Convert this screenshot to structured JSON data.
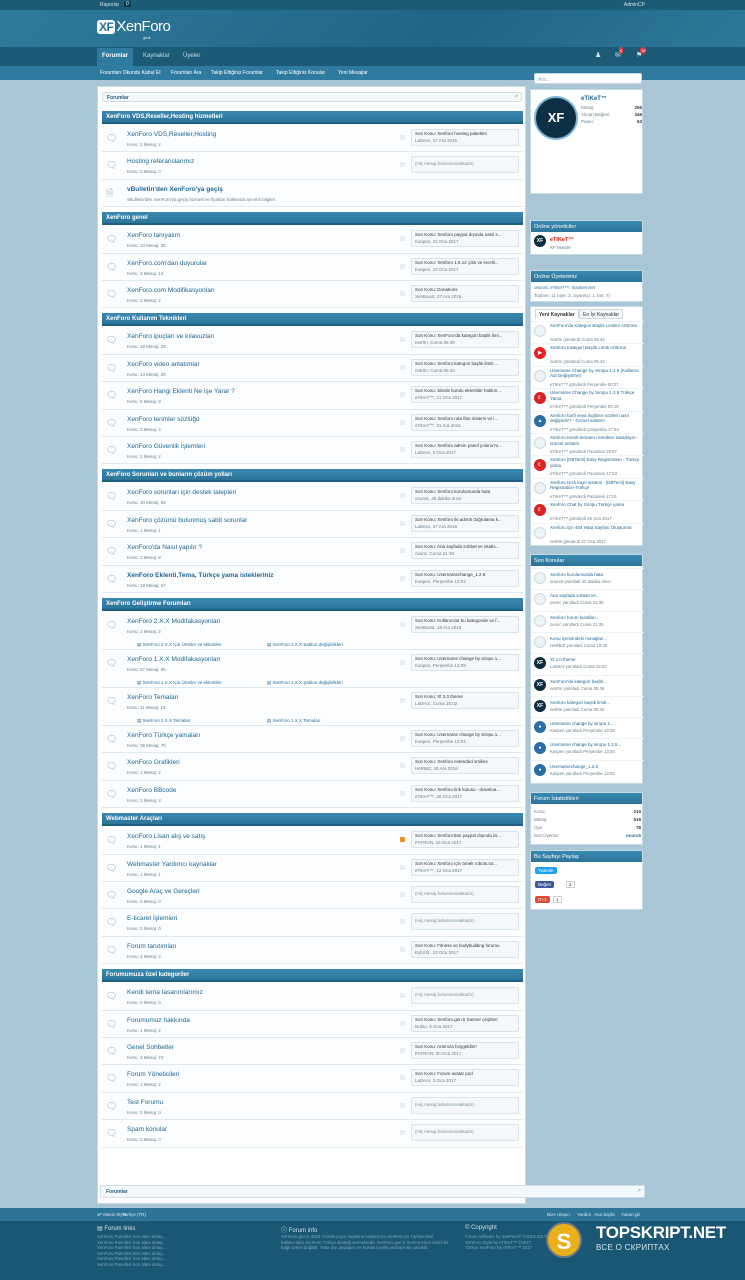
{
  "topbar": {
    "reports": "Raporlar",
    "reports_count": "0",
    "admincp": "AdminCP"
  },
  "logo": {
    "mark": "XF",
    "name": "XenForo",
    "sub": "gen.tr"
  },
  "nav": {
    "tabs": [
      "Forumlar",
      "Kaynaklar",
      "Üyeler"
    ],
    "notif1": "9",
    "notif2": "19"
  },
  "subnav": [
    "Forumları Okundu Kabul Et",
    "Forumları Ara",
    "Takip Ettiğiniz Forumlar",
    "Takip Ettiğiniz Konular",
    "Yeni Mesajlar"
  ],
  "breadcrumb": "Forumlar",
  "categories": [
    {
      "title": "XenForo VDS,Reseller,Hosting hizmetleri",
      "nodes": [
        {
          "title": "XenForo VDS,Reseller,Hosting",
          "stats": "Konu: 2  Mesaj: 2",
          "last1": "Son Konu: Xenforo hosting paketleri",
          "last2": "LaDecs, 27 Ara 2016",
          "bold": false,
          "icon": "bubble"
        },
        {
          "title": "Hosting referanslarımız",
          "stats": "Konu: 0  Mesaj: 0",
          "empty": "(Hiç mesaj bulunmamaktadır)",
          "icon": "bubble"
        },
        {
          "title": "vBulletin'den XenForo'ya geçiş",
          "stats": "vBulletin'den XenForo'ya geçiş hizmeti ve fiyatları hakkında ayrıntılı bilgiler.",
          "bold": true,
          "icon": "doc"
        }
      ]
    },
    {
      "title": "XenForo genel",
      "nodes": [
        {
          "title": "XenForo tanıyalım",
          "stats": "Konu: 10  Mesaj: 35",
          "last1": "Son Konu: Xenforo paypal dışında nasıl s...",
          "last2": "Kaspen, 22 Oca 2017",
          "icon": "bubble"
        },
        {
          "title": "XenForo.com'dan duyurular",
          "stats": "Konu: 3  Mesaj: 12",
          "last1": "Son Konu: Xenforo 1.5.12 çıktı ve incelil...",
          "last2": "Kaspen, 10 Oca 2017",
          "icon": "bubble"
        },
        {
          "title": "XenForo.com Modifikasyonları",
          "stats": "Konu: 2  Mesaj: 2",
          "last1": "Son Konu: Donations",
          "last2": "XenBoost, 27 Ara 2016",
          "icon": "bubble"
        }
      ]
    },
    {
      "title": "XenForo Kullanım Teknikleri",
      "nodes": [
        {
          "title": "XenForo ipuçları ve kılavuzları",
          "stats": "Konu: 18  Mesaj: 28",
          "last1": "Son Konu: XenForo'da kategori başlık limi...",
          "last2": "netr0n, Cuma 05:45",
          "icon": "bubble"
        },
        {
          "title": "XenForo video anlatımlar",
          "stats": "Konu: 13  Mesaj: 20",
          "last1": "Son Konu: Xenforo kategori başlık limiti ...",
          "last2": "netr0n, Cuma 05:42",
          "icon": "bubble"
        },
        {
          "title": "XenForo Hangi Eklenti Ne işe Yarar ?",
          "stats": "Konu: 5  Mesaj: 8",
          "last1": "Son Konu: Sitede kurulu eklentiler hakkın...",
          "last2": "eTiKeT™, 21 Oca 2017",
          "icon": "bubble"
        },
        {
          "title": "XenForo terimler sözlüğü",
          "stats": "Konu: 3  Mesaj: 4",
          "last1": "Son Konu: Xenforo rota fitre sistemi ve i...",
          "last2": "eTiKeT™, 31 Ara 2016",
          "icon": "bubble"
        },
        {
          "title": "XenForo Güvenlik İşlemleri",
          "stats": "Konu: 2  Mesaj: 2",
          "last1": "Son Konu: Xenforo admin panel yolunu?o...",
          "last2": "LaDecs, 5 Oca 2017",
          "icon": "bubble"
        }
      ]
    },
    {
      "title": "XenForo Sorunları ve bunların çözüm yolları",
      "nodes": [
        {
          "title": "XenForo sorunları için destek talepleri",
          "stats": "Konu: 10  Mesaj: 56",
          "last1": "Son Konu: Xenforo kurulumunda hata",
          "last2": "onurx5, 45 dakika önce",
          "icon": "bubble"
        },
        {
          "title": "XenForo çözümü bulunmuş sabit sorunlar",
          "stats": "Konu: 1  Mesaj: 1",
          "last1": "Son Konu: Xenforo iki adımlı doğrulama k...",
          "last2": "LaDecs, 27 Ara 2016",
          "icon": "bubble"
        },
        {
          "title": "XenForo'da Nasıl yapılır ?",
          "stats": "Konu: 2  Mesaj: 8",
          "last1": "Son Konu: Ana sayfada sohbet ve istatis...",
          "last2": "ovunc, Cuma 21:39",
          "icon": "bubble"
        },
        {
          "title": "XenForo Eklenti,Tema, Türkçe yama istekleriniz",
          "stats": "Konu: 18  Mesaj: 67",
          "last1": "Son Konu: Usernamechange_1.2.5",
          "last2": "Kaspen, Perşembe 13:04",
          "bold": true,
          "icon": "bubble"
        }
      ]
    },
    {
      "title": "XenForo Geliştirme Forumları",
      "nodes": [
        {
          "title": "XenForo 2.X.X Modifakasyonları",
          "stats": "Konu: 2  Mesaj: 2",
          "last1": "Son Konu: Kullanıcılar bu kategoride ve f...",
          "last2": "XenBoost, 18 Ara 2016",
          "icon": "bubble",
          "subs": [
            "XenForo 2.X.X İçin Ürünler ve eklentiler",
            "XenForo 2.X.X Şablon değişiklikleri"
          ]
        },
        {
          "title": "XenForo 1.X.X Modifakasyonları",
          "stats": "Konu: 57  Mesaj: 95",
          "last1": "Son Konu: Username change by siropu 1...",
          "last2": "Kaspen, Perşembe 13:09",
          "icon": "bubble",
          "subs": [
            "XenForo 1.X.X İçin Ürünler ve eklentiler",
            "XenForo 1.X.X Şablon değişiklikleri"
          ]
        },
        {
          "title": "XenForo Temaları",
          "stats": "Konu: 11  Mesaj: 19",
          "last1": "Son Konu: Xf 2.0 theme",
          "last2": "LaDecs, Cuma 15:02",
          "icon": "bubble",
          "subs": [
            "XenForo 2.X.X Temaları",
            "XenForo 1.X.X Temaları"
          ]
        },
        {
          "title": "XenForo Türkçe yamaları",
          "stats": "Konu: 36  Mesaj: 70",
          "last1": "Son Konu: Username change by siropu 1...",
          "last2": "Kaspen, Perşembe 13:04",
          "icon": "bubble"
        },
        {
          "title": "XenForo Grafikleri",
          "stats": "Konu: 1  Mesaj: 2",
          "last1": "Son Konu: Xenforo extended smilies",
          "last2": "HeRBIZ, 29 Ara 2016",
          "icon": "bubble"
        },
        {
          "title": "XenForo BBcode",
          "stats": "Konu: 3  Mesaj: 3",
          "last1": "Son Konu: Xenforo link kutusu - downloa...",
          "last2": "eTiKeT™, 28 Oca 2017",
          "icon": "bubble"
        }
      ]
    },
    {
      "title": "Webmaster Araçları",
      "nodes": [
        {
          "title": "XenForo Lisan alış ve satış",
          "stats": "Konu: 1  Mesaj: 1",
          "last1": "Son Konu: Xenforo'dan paypal dışında lis...",
          "last2": "PATRON, 19 Oca 2017",
          "icon": "bubble",
          "rss": "or"
        },
        {
          "title": "Webmaster Yardımcı kaynaklar",
          "stats": "Konu: 1  Mesaj: 1",
          "last1": "Son Konu: Xenforo için örnek robots.txt...",
          "last2": "eTiKeT™, 12 Oca 2017",
          "icon": "bubble"
        },
        {
          "title": "Google Araç ve Gereçleri",
          "stats": "Konu: 0  Mesaj: 0",
          "empty": "(Hiç mesaj bulunmamaktadır)",
          "icon": "bubble"
        },
        {
          "title": "E-ticaret İşlemleri",
          "stats": "Konu: 0  Mesaj: 0",
          "empty": "(Hiç mesaj bulunmamaktadır)",
          "icon": "bubble"
        },
        {
          "title": "Forum tanıtımları",
          "stats": "Konu: 4  Mesaj: 4",
          "last1": "Son Konu: Fitness ve bodybuilding forumu",
          "last2": "Eylül B., 23 Oca 2017",
          "icon": "bubble"
        }
      ]
    },
    {
      "title": "Forumumuza özel kategoriler",
      "nodes": [
        {
          "title": "Kendi tema tasarımlarımız",
          "stats": "Konu: 0  Mesaj: 0",
          "empty": "(Hiç mesaj bulunmamaktadır)",
          "icon": "bubble"
        },
        {
          "title": "Forumumuz hakkında",
          "stats": "Konu: 1  Mesaj: 2",
          "last1": "Son Konu: Xenforo.gen.tr banner çeşitleri",
          "last2": "Noktu, 6 Oca 2017",
          "icon": "bubble"
        },
        {
          "title": "Genel Sohbetler",
          "stats": "Konu: 3  Mesaj: 73",
          "last1": "Son Konu: Aramıza hoşgeldin!!",
          "last2": "PATRON, 30 Oca 2017",
          "icon": "bubble"
        },
        {
          "title": "Forum Yöneticileri",
          "stats": "Konu: 1  Mesaj: 2",
          "last1": "Son Konu: Forum avatar pod",
          "last2": "LaDecs, 3 Oca 2017",
          "icon": "bubble"
        },
        {
          "title": "Test Forumu",
          "stats": "Konu: 0  Mesaj: 0",
          "empty": "(Hiç mesaj bulunmamaktadır)",
          "icon": "bubble"
        },
        {
          "title": "Spam konular",
          "stats": "Konu: 0  Mesaj: 0",
          "empty": "(Hiç mesaj bulunmamaktadır)",
          "icon": "bubble"
        }
      ]
    }
  ],
  "sidebar": {
    "search_placeholder": "Ara...",
    "visitor": {
      "name": "eTiKeT™",
      "avatar": "XF",
      "stats": [
        [
          "Mesaj:",
          "206"
        ],
        [
          "Alınan Beğeni:",
          "346"
        ],
        [
          "Puanı:",
          "63"
        ]
      ]
    },
    "online_mods": {
      "title": "Online yöneticiler",
      "name": "eTiKeT™",
      "role": "XF Master"
    },
    "online_users": {
      "title": "Online Üyelerimiz",
      "users": "onurx5, eTiKeT™, maxkernner",
      "count": "Toplam: 11 (üye: 3, ziyaretçi: 1, bot: 7)"
    },
    "resources": {
      "tabs": [
        "Yeni Kaynaklar",
        "En İyi Kaynaklar"
      ],
      "items": [
        {
          "t": "XenForo'da Kategori Başlık Limitini Arttırma",
          "m": "netr0n gönderdi Cuma 05:45",
          "icon": "pk"
        },
        {
          "t": "Xenforo Kategori Başlık Limiti Arttırma",
          "m": "netr0n gönderdi Cuma 05:42",
          "icon": "rd"
        },
        {
          "t": "Username Change by Siropu 1.2.5 (Kullanıcı Adı Değiştirme)",
          "m": "eTiKeT™ gönderdi Perşembe 00:27",
          "icon": "pk"
        },
        {
          "t": "Username Change by Siropu 1.2.5 Türkçe Yama",
          "m": "eTiKeT™ gönderdi Perşembe 00:19",
          "icon": "tr"
        },
        {
          "t": "Xenforo harfi veya ingilizce sözleri nasıl değiştirilir? - Görsel anlatım",
          "m": "eTiKeT™ gönderdi Çarşamba 17:54",
          "icon": "bl"
        },
        {
          "t": "Xenforo Kendi temanızı kendiniz tasarlayın - Görsel anlatım",
          "m": "eTiKeT™ gönderdi Pazartesi 20:57",
          "icon": "pk"
        },
        {
          "t": "Xenforo [DBTech] Easy Registration - Türkçe yama",
          "m": "eTiKeT™ gönderdi Pazartesi 17:03",
          "icon": "tr"
        },
        {
          "t": "Xenforo Hızlı kayıt sistemi - [DBTech] Easy Registration-Türkçe",
          "m": "eTiKeT™ gönderdi Pazartesi 17:01",
          "icon": "pk"
        },
        {
          "t": "Xenforo Chat by Siropu Türkçe yama",
          "m": "eTiKeT™ gönderdi 29 Oca 2017",
          "icon": "tr"
        },
        {
          "t": "Xenforo için 404 Hata Sayfası Oluşturma",
          "m": "netr0n gönderdi 27 Oca 2017",
          "icon": "pk"
        }
      ]
    },
    "new_topics": {
      "title": "Son Konular",
      "items": [
        {
          "t": "Xenforo kurulumunda hata",
          "m": "onurx5 yanıtladı 45 dakika önce",
          "icon": "pk"
        },
        {
          "t": "Ana sayfada sohbet ve...",
          "m": "ovunc yanıtladı Cuma 21:39",
          "icon": "pk"
        },
        {
          "t": "Xenforo forum kuralları...",
          "m": "ovunc yanıtladı Cuma 21:35",
          "icon": "pk"
        },
        {
          "t": "Konu içerisindeki mesajları...",
          "m": "HeRBIZ yanıtladı Cuma 15:33",
          "icon": "pk"
        },
        {
          "t": "Xf 2.0 theme",
          "m": "LaDecs yanıtladı Cuma 15:02",
          "icon": "xf"
        },
        {
          "t": "XenForo'da kategori başlık...",
          "m": "netr0n yanıtladı Cuma 05:45",
          "icon": "xf"
        },
        {
          "t": "Xenforo kategori başlık limiti...",
          "m": "netr0n yanıtladı Cuma 05:42",
          "icon": "xf"
        },
        {
          "t": "Username change by siropu 1...",
          "m": "Kaspen yanıtladı Perşembe 13:09",
          "icon": "bl"
        },
        {
          "t": "Username change by siropu 1.2.5...",
          "m": "Kaspen yanıtladı Perşembe 13:04",
          "icon": "bl"
        },
        {
          "t": "Usernamechange_1.2.5",
          "m": "Kaspen yanıtladı Perşembe 13:04",
          "icon": "bl"
        }
      ]
    },
    "stats": {
      "title": "Forum İstatistikleri",
      "rows": [
        [
          "Konu:",
          "210"
        ],
        [
          "Mesaj:",
          "519"
        ],
        [
          "Üye:",
          "78"
        ],
        [
          "Son Üyemiz:",
          "onurx5"
        ]
      ]
    },
    "share": {
      "title": "Bu Sayfayı Paylaş",
      "tweet": "Tweetle",
      "fb": "Beğen",
      "fb_count": "3",
      "gp": "G+1",
      "gp_count": "1"
    }
  },
  "footbar": {
    "left": [
      "xF Mavis Style",
      "Türkçe (TR)"
    ],
    "right": [
      "Bize Ulaşın",
      "Yardım",
      "Ana Sayfa",
      "Yukarı git"
    ]
  },
  "footer": {
    "links_title": "Forum links",
    "links": [
      "XenForo Panelleri Son alanı detay...",
      "XenForo Panelleri Son alanı detay...",
      "XenForo Panelleri Son alanı detay...",
      "XenForo Panelleri Son alanı detay...",
      "XenForo Panelleri Son alanı detay...",
      "XenForo Panelleri Son alanı detay..."
    ],
    "info_title": "Forum info",
    "info": "XenForo.gen.tr 2016 Yılında yayın hayatına başlamıştır.XenForo'ya Türkiye'deki kullanıcılara XenForo Türkçe desteği vermektedir. XenForo.gen.tr XenForo'nun resmi bir bağlı şirketi değildir. Yasa dışı paylaşım ve hukuki içerikli paylaşımlar yasaktır.",
    "copy_title": "Copyright",
    "copy": [
      "Forum software by XenForo® ©2010-2017 XenForo Ltd.",
      "XenForo Style by eTiKeT™ ©2017",
      "Türkçe XenForo By eTiKeT™ 2017"
    ]
  },
  "watermark": {
    "letter": "S",
    "name": "TOPSKRIPT.NET",
    "tagline": "ВСЕ О СКРИПТАХ"
  }
}
